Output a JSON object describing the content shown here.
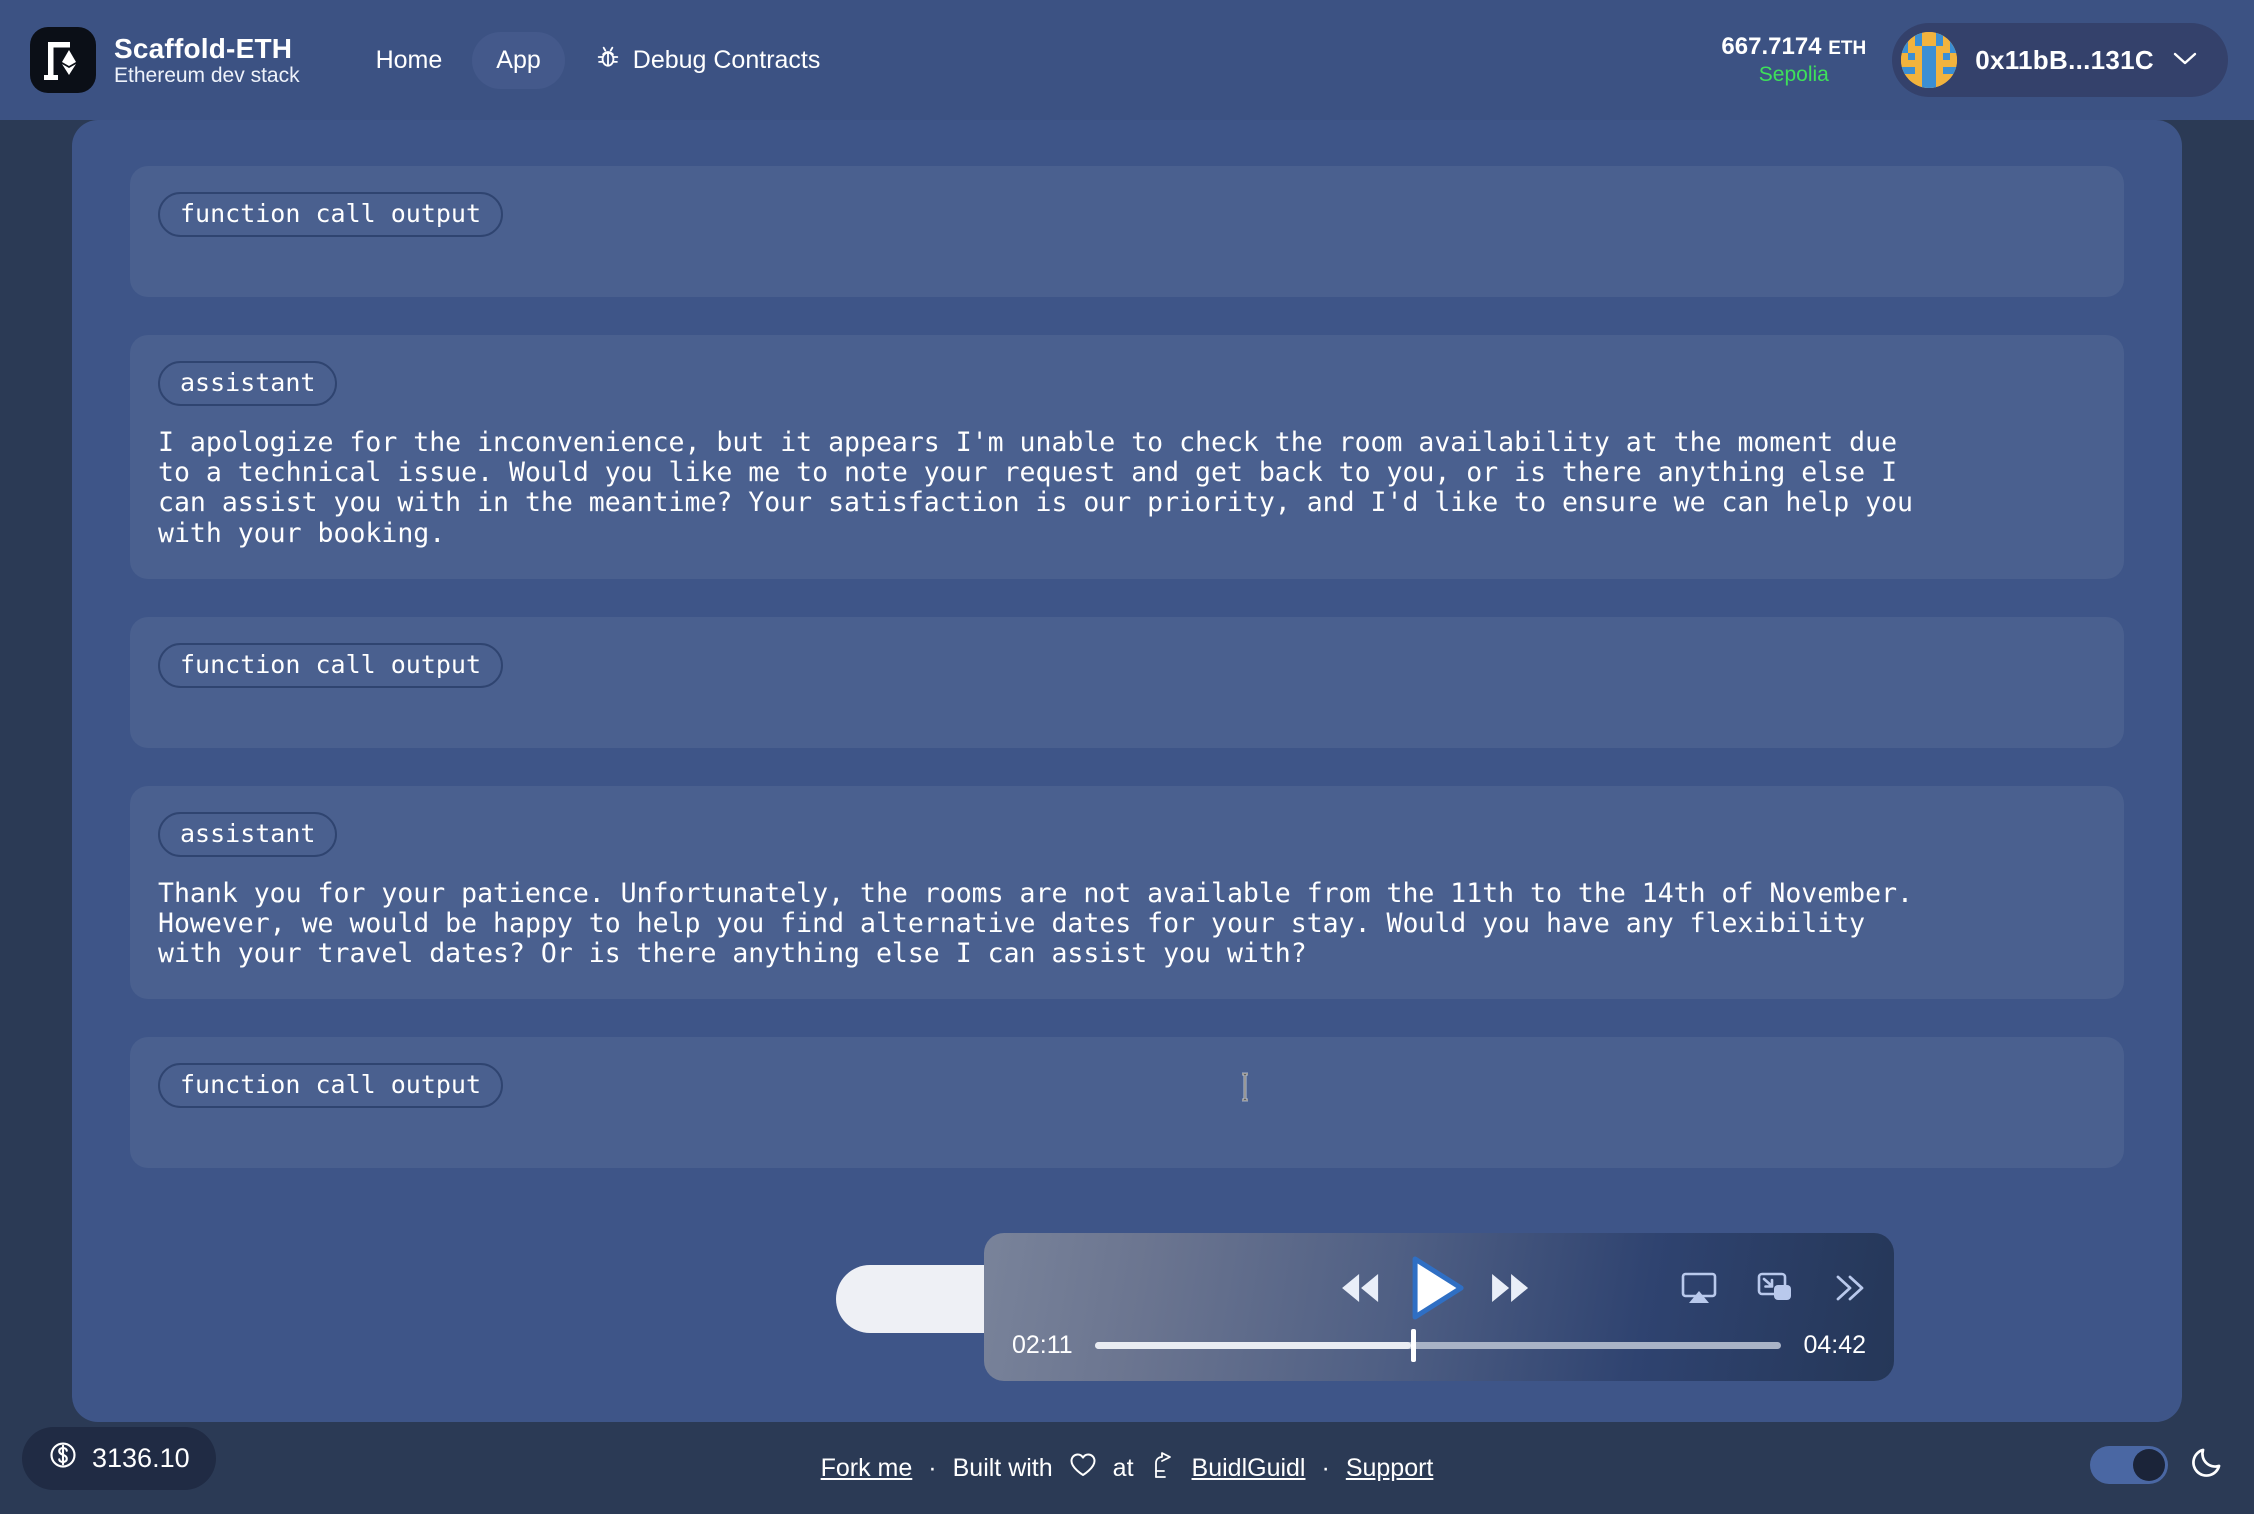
{
  "header": {
    "brand": {
      "title": "Scaffold-ETH",
      "subtitle": "Ethereum dev stack",
      "logo_icon": "scaffold-eth-logo-icon"
    },
    "nav": [
      {
        "label": "Home",
        "icon": null,
        "active": false
      },
      {
        "label": "App",
        "icon": null,
        "active": true
      },
      {
        "label": "Debug Contracts",
        "icon": "bug-icon",
        "active": false
      }
    ],
    "balance": {
      "amount": "667.7174",
      "unit": "ETH",
      "network": "Sepolia",
      "network_color": "#3ee05a"
    },
    "wallet": {
      "address": "0x11bB...131C",
      "chevron_icon": "chevron-down-icon",
      "avatar_icon": "blockie-avatar"
    }
  },
  "chat": {
    "messages": [
      {
        "role": "function call output",
        "text": ""
      },
      {
        "role": "assistant",
        "text": "I apologize for the inconvenience, but it appears I'm unable to check the room availability at the moment due\nto a technical issue. Would you like me to note your request and get back to you, or is there anything else I\ncan assist you with in the meantime? Your satisfaction is our priority, and I'd like to ensure we can help you\nwith your booking."
      },
      {
        "role": "function call output",
        "text": ""
      },
      {
        "role": "assistant",
        "text": "Thank you for your patience. Unfortunately, the rooms are not available from the 11th to the 14th of November.\nHowever, we would be happy to help you find alternative dates for your stay. Would you have any flexibility\nwith your travel dates? Or is there anything else I can assist you with?"
      },
      {
        "role": "function call output",
        "text": ""
      }
    ]
  },
  "player": {
    "current_time": "02:11",
    "duration": "04:42",
    "progress_percent": 46,
    "state": "paused",
    "buttons": {
      "rewind": "rewind-icon",
      "play": "play-icon",
      "fast_forward": "fast-forward-icon",
      "airplay": "airplay-icon",
      "picture_in_picture": "picture-in-picture-icon",
      "more": "chevron-double-right-icon"
    }
  },
  "footer": {
    "links": [
      {
        "label": "Fork me",
        "underline": true
      },
      {
        "label": "Built with",
        "underline": false
      },
      {
        "label": "at",
        "underline": false
      },
      {
        "label": "BuidlGuidl",
        "underline": true
      },
      {
        "label": "Support",
        "underline": true
      }
    ],
    "separator": "·",
    "heart_icon": "heart-icon",
    "buidlguidl_icon": "buidlguidl-castle-icon",
    "price": {
      "value": "3136.10",
      "icon": "dollar-circle-icon"
    },
    "theme": {
      "toggle_on": true,
      "icon": "moon-icon"
    }
  }
}
